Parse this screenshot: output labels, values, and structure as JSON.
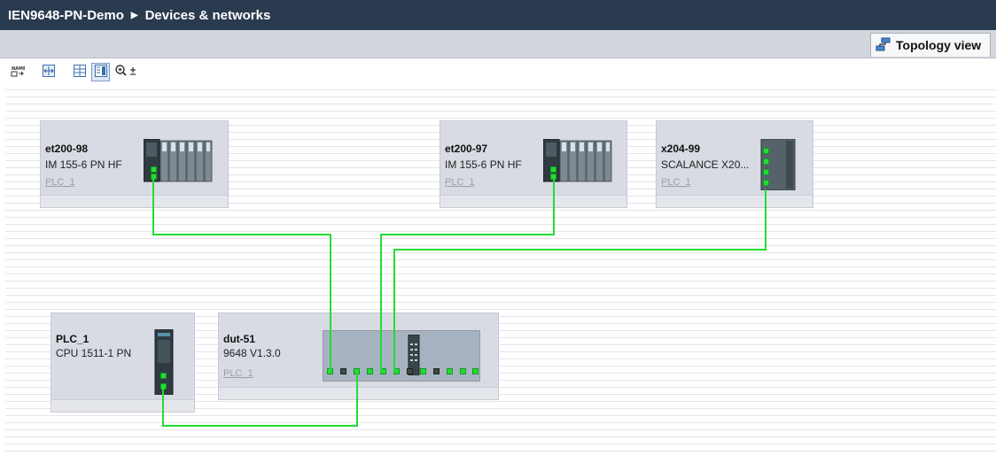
{
  "title": {
    "project": "IEN9648-PN-Demo",
    "separator": "▶",
    "section": "Devices & networks"
  },
  "view_tab": {
    "label": "Topology view",
    "icon": "topology-icon"
  },
  "toolbar": {
    "buttons": [
      {
        "name": "show-names-button",
        "icon": "name-tag-icon",
        "active": false
      },
      {
        "name": "fit-page-button",
        "icon": "fit-width-icon",
        "active": false
      },
      {
        "name": "grid-button",
        "icon": "grid-icon",
        "active": false
      },
      {
        "name": "overview-button",
        "icon": "overview-icon",
        "active": true
      },
      {
        "name": "zoom-button",
        "icon": "zoom-in-icon",
        "active": false
      }
    ]
  },
  "devices": {
    "et200_98": {
      "name": "et200-98",
      "type": "IM 155-6 PN HF",
      "controller": "PLC_1"
    },
    "et200_97": {
      "name": "et200-97",
      "type": "IM 155-6 PN HF",
      "controller": "PLC_1"
    },
    "x204_99": {
      "name": "x204-99",
      "type": "SCALANCE X20...",
      "controller": "PLC_1"
    },
    "plc_1": {
      "name": "PLC_1",
      "type": "CPU 1511-1 PN"
    },
    "dut_51": {
      "name": "dut-51",
      "type": "9648 V1.3.0",
      "controller": "PLC_1"
    }
  },
  "colors": {
    "title_bar": "#2a3a4f",
    "device_box": "#d8dbe3",
    "link": "#22dd33"
  }
}
